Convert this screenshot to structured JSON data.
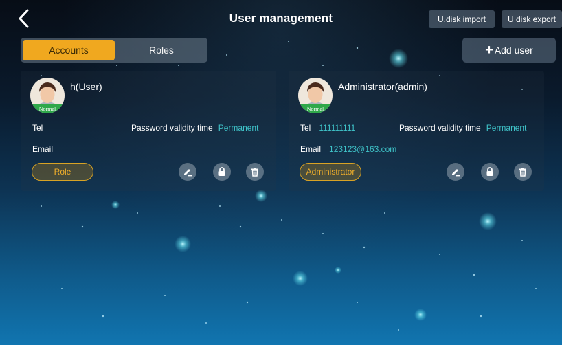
{
  "header": {
    "title": "User management",
    "import_label": "U.disk import",
    "export_label": "U disk export"
  },
  "tabs": [
    {
      "label": "Accounts",
      "active": true
    },
    {
      "label": "Roles",
      "active": false
    }
  ],
  "add_user_label": "Add user",
  "labels": {
    "tel": "Tel",
    "email": "Email",
    "password_validity": "Password validity time"
  },
  "users": [
    {
      "name": "h(User)",
      "badge": "Normal",
      "tel": "",
      "email": "",
      "password_validity": "Permanent",
      "role": "Role"
    },
    {
      "name": "Administrator(admin)",
      "badge": "Normal",
      "tel": "111111111",
      "email": "123123@163.com",
      "password_validity": "Permanent",
      "role": "Administrator"
    }
  ],
  "icons": [
    "back-icon",
    "plus-icon",
    "edit-icon",
    "lock-icon",
    "trash-icon"
  ],
  "colors": {
    "accent": "#f0a81f",
    "teal_value": "#3fc3c9",
    "badge_green": "#2fa84a"
  }
}
